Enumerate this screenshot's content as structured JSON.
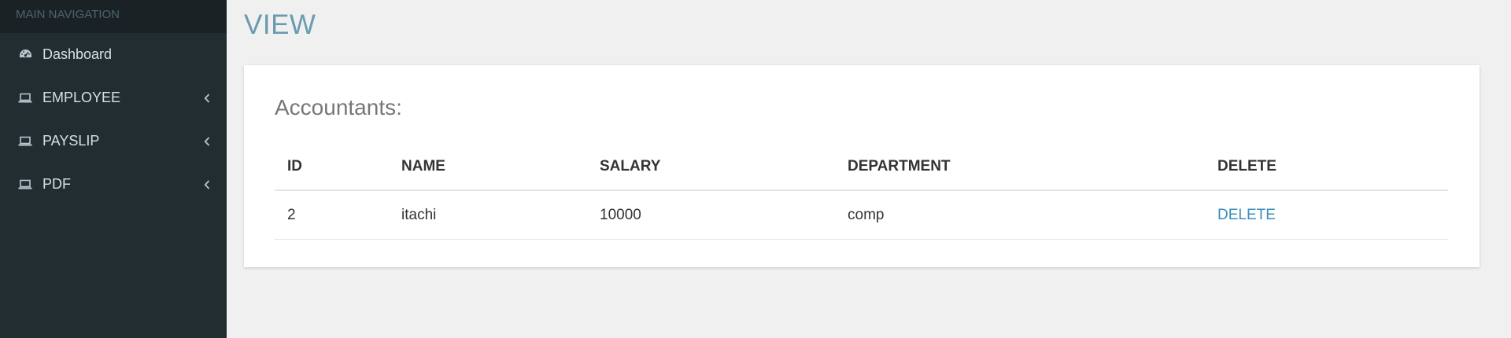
{
  "sidebar": {
    "header": "MAIN NAVIGATION",
    "items": [
      {
        "label": "Dashboard",
        "icon": "dashboard-icon",
        "has_chevron": false
      },
      {
        "label": "EMPLOYEE",
        "icon": "laptop-icon",
        "has_chevron": true
      },
      {
        "label": "PAYSLIP",
        "icon": "laptop-icon",
        "has_chevron": true
      },
      {
        "label": "PDF",
        "icon": "laptop-icon",
        "has_chevron": true
      }
    ]
  },
  "main": {
    "page_title": "VIEW",
    "box_title": "Accountants:",
    "table": {
      "columns": [
        "ID",
        "NAME",
        "SALARY",
        "DEPARTMENT",
        "DELETE"
      ],
      "rows": [
        {
          "id": "2",
          "name": "itachi",
          "salary": "10000",
          "department": "comp",
          "action": "DELETE"
        }
      ]
    }
  },
  "colors": {
    "sidebar_bg": "#222d32",
    "sidebar_header_bg": "#1a2226",
    "title_color": "#6a9bb0",
    "link_color": "#3c8dbc"
  }
}
